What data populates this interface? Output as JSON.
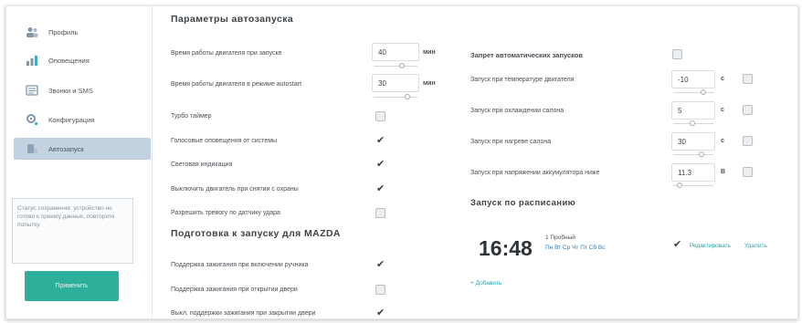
{
  "sidebar": {
    "items": [
      {
        "label": "Профиль",
        "icon": "users-icon",
        "active": false
      },
      {
        "label": "Оповещения",
        "icon": "chart-icon",
        "active": false
      },
      {
        "label": "Звонки и SMS",
        "icon": "list-icon",
        "active": false
      },
      {
        "label": "Конфигурация",
        "icon": "gear-icon",
        "active": false
      },
      {
        "label": "Автозапуск",
        "icon": "car-icon",
        "active": true
      }
    ],
    "status_text": "Статус сохранения: устройство не готово к приему данных, повторите попытку",
    "apply_label": "Применить"
  },
  "autostart": {
    "title": "Параметры автозапуска",
    "engine_time_label": "Время работы двигателя при запуске",
    "engine_time_value": "40",
    "engine_time_unit": "мин",
    "engine_time_turbo_label": "Время работы двигателя в режиме autostart",
    "engine_time_turbo_value": "30",
    "engine_time_turbo_unit": "мин",
    "turbo_timer_label": "Турбо таймер",
    "sound_notify_label": "Голосовые оповещения от системы",
    "light_indication_label": "Световая индикация",
    "shutdown_label": "Выключить двигатель при снятии с охраны",
    "allow_trunk_label": "Разрешить тревогу по датчику удара"
  },
  "preparation": {
    "title": "Подготовка к запуску для MAZDA",
    "ignition_hold_label": "Поддержка зажигания при включении ручника",
    "door_hold_label": "Поддержка зажигания при открытии двери",
    "exit_hold_label": "Выкл. поддержки зажигания при закрытии двери"
  },
  "conditions": {
    "title": "Запрет автоматических запусков",
    "engine_temp_label": "Запуск при температуре двигателя",
    "engine_temp_value": "-10",
    "engine_temp_unit": "с",
    "cabin_cool_label": "Запуск при охлаждении салона",
    "cabin_cool_value": "5",
    "cabin_cool_unit": "с",
    "cabin_heat_label": "Запуск при нагреве салона",
    "cabin_heat_value": "30",
    "cabin_heat_unit": "с",
    "battery_label": "Запуск при напряжении аккумулятора ниже",
    "battery_value": "11.3",
    "battery_unit": "В"
  },
  "schedule": {
    "title": "Запуск по расписанию",
    "time": "16:48",
    "label": "1 Пробный",
    "days": "Пн Вт Ср Чт Пт Сб Вс",
    "edit_label": "Редактировать",
    "delete_label": "Удалить",
    "add_label": "+ Добавить"
  },
  "checkboxes": {
    "turbo_timer": false,
    "sound_notify": true,
    "light_indication": true,
    "shutdown": true,
    "allow_trunk": false,
    "ignition_hold": true,
    "door_hold": false,
    "exit_hold": true,
    "forbid_auto": false,
    "engine_temp": false,
    "cabin_cool": false,
    "cabin_heat": false,
    "battery": false,
    "schedule_enabled": true
  },
  "colors": {
    "accent": "#2eaf9b",
    "active_nav": "#c3d2e0",
    "link": "#2aa3a8"
  }
}
